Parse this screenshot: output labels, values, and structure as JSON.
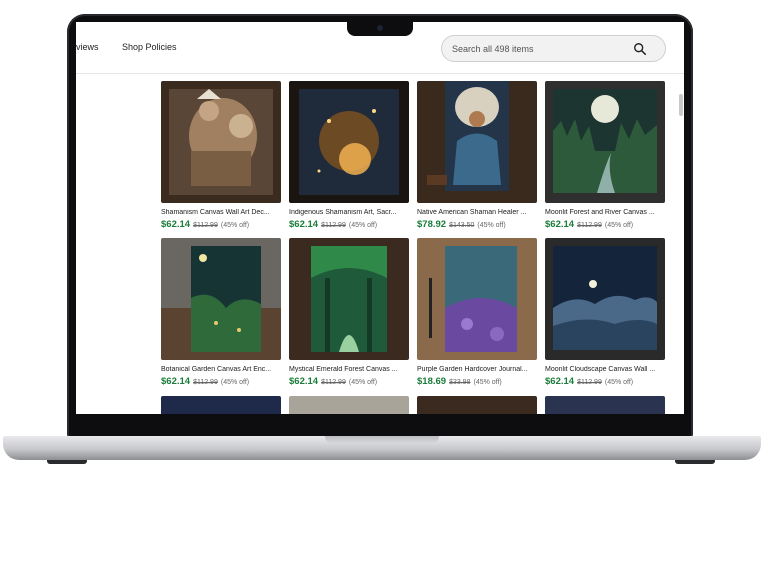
{
  "nav": {
    "reviews_label": "views",
    "policies_label": "Shop Policies"
  },
  "search": {
    "placeholder": "Search all 498 items",
    "icon": "search-icon"
  },
  "products": [
    {
      "title": "Shamanism Canvas Wall Art Dec...",
      "price": "$62.14",
      "original": "$112.99",
      "discount": "(45% off)"
    },
    {
      "title": "Indigenous Shamanism Art, Sacr...",
      "price": "$62.14",
      "original": "$112.99",
      "discount": "(45% off)"
    },
    {
      "title": "Native American Shaman Healer ...",
      "price": "$78.92",
      "original": "$143.50",
      "discount": "(45% off)"
    },
    {
      "title": "Moonlit Forest and River Canvas ...",
      "price": "$62.14",
      "original": "$112.99",
      "discount": "(45% off)"
    },
    {
      "title": "Botanical Garden Canvas Art Enc...",
      "price": "$62.14",
      "original": "$112.99",
      "discount": "(45% off)"
    },
    {
      "title": "Mystical Emerald Forest Canvas ...",
      "price": "$62.14",
      "original": "$112.99",
      "discount": "(45% off)"
    },
    {
      "title": "Purple Garden Hardcover Journal...",
      "price": "$18.69",
      "original": "$33.98",
      "discount": "(45% off)"
    },
    {
      "title": "Moonlit Cloudscape Canvas Wall ...",
      "price": "$62.14",
      "original": "$112.99",
      "discount": "(45% off)"
    }
  ],
  "colors": {
    "price_green": "#1a7d3a",
    "search_bg": "#f2f2f2"
  }
}
